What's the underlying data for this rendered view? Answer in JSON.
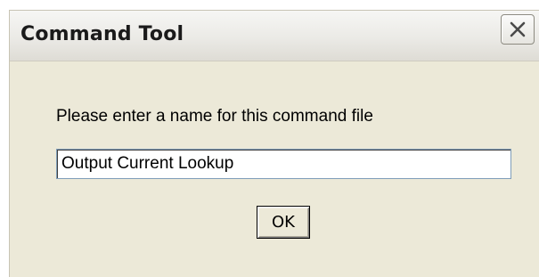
{
  "window": {
    "title": "Command Tool",
    "close_icon": "close-icon"
  },
  "dialog": {
    "prompt": "Please enter a name for this command file",
    "name_value": "Output Current Lookup",
    "ok_label": "OK"
  }
}
